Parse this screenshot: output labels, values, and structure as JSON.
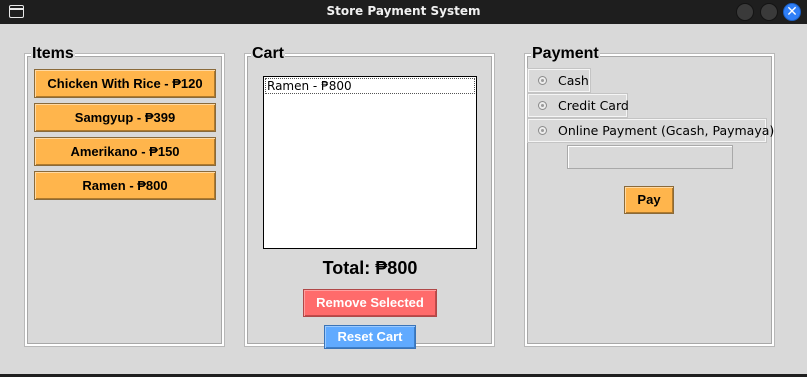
{
  "window": {
    "title": "Store Payment System",
    "close_glyph": "✕",
    "icons": {
      "app": "window-icon",
      "minimize": "minimize-icon",
      "maximize": "maximize-icon",
      "close": "close-icon"
    }
  },
  "items": {
    "label": "Items",
    "buttons": [
      "Chicken With Rice - ₱120",
      "Samgyup - ₱399",
      "Amerikano - ₱150",
      "Ramen - ₱800"
    ]
  },
  "cart": {
    "label": "Cart",
    "entries": [
      "Ramen - ₱800"
    ],
    "total": "Total: ₱800",
    "remove_label": "Remove Selected",
    "reset_label": "Reset Cart"
  },
  "payment": {
    "label": "Payment",
    "options": [
      "Cash",
      "Credit Card",
      "Online Payment (Gcash, Paymaya)"
    ],
    "selected": null,
    "input_value": "",
    "pay_label": "Pay"
  },
  "colors": {
    "item_button": "#ffb54c",
    "remove_button": "#ff6b6b",
    "reset_button": "#60aaff",
    "background": "#d9d9d9"
  }
}
